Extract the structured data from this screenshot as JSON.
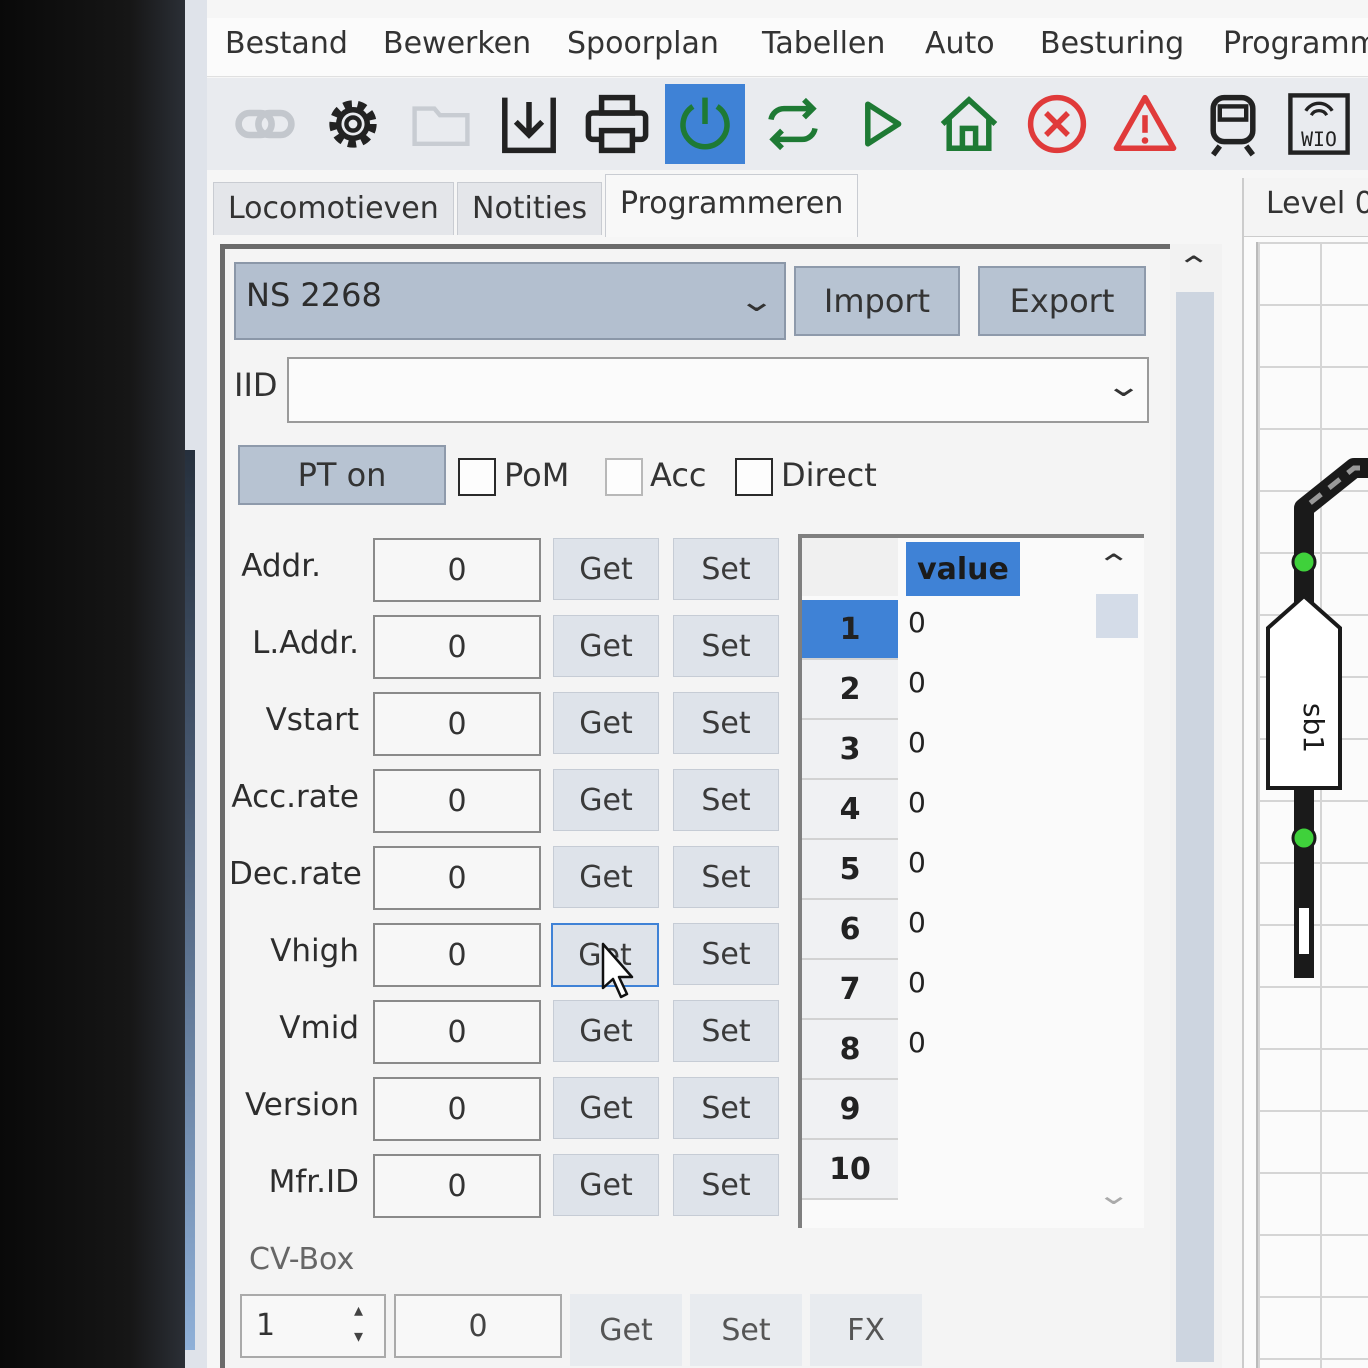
{
  "menu": [
    "Bestand",
    "Bewerken",
    "Spoorplan",
    "Tabellen",
    "Auto",
    "Besturing",
    "Programm"
  ],
  "toolbar_icons": [
    "link-icon",
    "gear-icon",
    "folder-icon",
    "download-icon",
    "print-icon",
    "power-icon",
    "refresh-icon",
    "play-icon",
    "home-icon",
    "stop-icon",
    "warning-icon",
    "train-icon",
    "wio-icon"
  ],
  "toolbar": {
    "wio_label": "WIO"
  },
  "tabs": [
    "Locomotieven",
    "Notities",
    "Programmeren"
  ],
  "active_tab": "Programmeren",
  "programmer": {
    "loco": "NS 2268",
    "import_label": "Import",
    "export_label": "Export",
    "iid_label": "IID",
    "iid_value": "",
    "pt_button": "PT on",
    "checkboxes": [
      "PoM",
      "Acc",
      "Direct"
    ],
    "rows": [
      {
        "label": "Addr.",
        "value": "0"
      },
      {
        "label": "L.Addr.",
        "value": "0"
      },
      {
        "label": "Vstart",
        "value": "0"
      },
      {
        "label": "Acc.rate",
        "value": "0"
      },
      {
        "label": "Dec.rate",
        "value": "0"
      },
      {
        "label": "Vhigh",
        "value": "0"
      },
      {
        "label": "Vmid",
        "value": "0"
      },
      {
        "label": "Version",
        "value": "0"
      },
      {
        "label": "Mfr.ID",
        "value": "0"
      }
    ],
    "get_label": "Get",
    "set_label": "Set"
  },
  "cv_table": {
    "header": "value",
    "rows": [
      {
        "cv": "1",
        "value": "0"
      },
      {
        "cv": "2",
        "value": "0"
      },
      {
        "cv": "3",
        "value": "0"
      },
      {
        "cv": "4",
        "value": "0"
      },
      {
        "cv": "5",
        "value": "0"
      },
      {
        "cv": "6",
        "value": "0"
      },
      {
        "cv": "7",
        "value": "0"
      },
      {
        "cv": "8",
        "value": "0"
      },
      {
        "cv": "9",
        "value": ""
      },
      {
        "cv": "10",
        "value": ""
      }
    ],
    "selected_row": "1"
  },
  "cv_box": {
    "label": "CV-Box",
    "cv_number": "1",
    "value": "0",
    "get_label": "Get",
    "set_label": "Set",
    "fx_label": "FX"
  },
  "level_tab": "Level 0",
  "track_block_label": "sb1",
  "colors": {
    "accent": "#3f82d6",
    "button": "#b7c3d2",
    "power": "#1e7a34",
    "stop": "#e03a3a",
    "signal": "#3fd13b"
  }
}
